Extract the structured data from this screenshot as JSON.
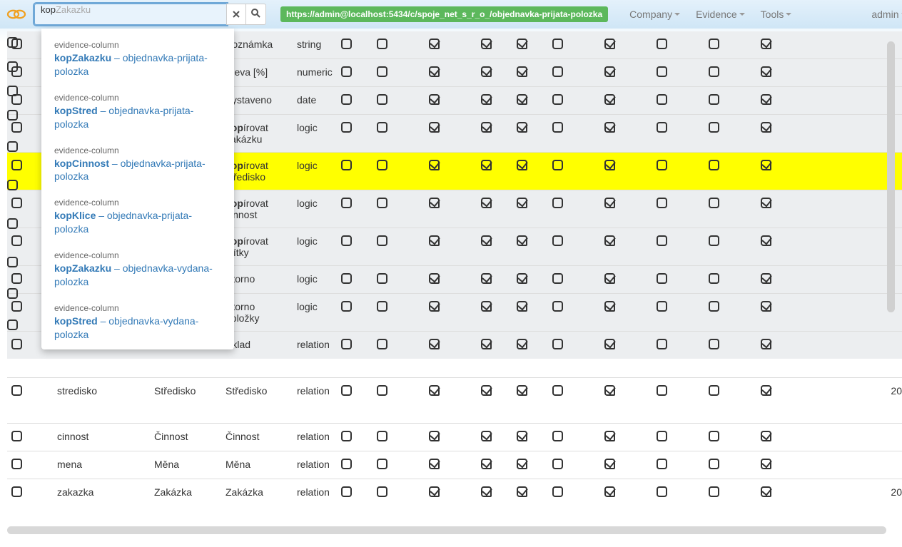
{
  "navbar": {
    "search_typed": "kop",
    "search_hint_rest": "Zakazku",
    "url": "https://admin@localhost:5434/c/spoje_net_s_r_o_/objednavka-prijata-polozka",
    "menu": {
      "company": "Company",
      "evidence": "Evidence",
      "tools": "Tools",
      "admin": "admin"
    }
  },
  "suggestions": [
    {
      "cat": "evidence-column",
      "bold": "kopZakazku",
      "rest": " – objednavka-prijata-polozka"
    },
    {
      "cat": "evidence-column",
      "bold": "kopStred",
      "rest": " – objednavka-prijata-polozka"
    },
    {
      "cat": "evidence-column",
      "bold": "kopCinnost",
      "rest": " – objednavka-prijata-polozka"
    },
    {
      "cat": "evidence-column",
      "bold": "kopKlice",
      "rest": " – objednavka-prijata-polozka"
    },
    {
      "cat": "evidence-column",
      "bold": "kopZakazku",
      "rest": " – objednavka-vydana-polozka"
    },
    {
      "cat": "evidence-column",
      "bold": "kopStred",
      "rest": " – objednavka-vydana-polozka"
    }
  ],
  "rows": [
    {
      "hl": false,
      "prop": "",
      "l1": "",
      "l2_plain": "Poznámka",
      "type": "string",
      "pat": [
        0,
        0,
        1,
        1,
        1,
        0,
        1,
        0,
        0,
        1
      ],
      "tail": ""
    },
    {
      "hl": false,
      "prop": "",
      "l1": "",
      "l2_plain": "Sleva [%]",
      "type": "numeric",
      "pat": [
        0,
        0,
        1,
        1,
        1,
        0,
        1,
        0,
        0,
        1
      ],
      "tail": ""
    },
    {
      "hl": false,
      "prop": "",
      "l1": "",
      "l2_plain": "Vystaveno",
      "type": "date",
      "pat": [
        0,
        0,
        1,
        1,
        1,
        0,
        1,
        0,
        0,
        1
      ],
      "tail": ""
    },
    {
      "hl": false,
      "prop": "",
      "l1": "",
      "l2_bold": "kop",
      "l2_rest": "írovat zakázku",
      "type": "logic",
      "pat": [
        0,
        0,
        1,
        1,
        1,
        0,
        1,
        0,
        0,
        1
      ],
      "tail": ""
    },
    {
      "hl": true,
      "prop": "",
      "l1": "",
      "l2_bold": "kop",
      "l2_rest": "írovat středisko",
      "type": "logic",
      "pat": [
        0,
        0,
        1,
        1,
        1,
        0,
        1,
        0,
        0,
        1
      ],
      "tail": ""
    },
    {
      "hl": false,
      "prop": "",
      "l1": "",
      "l2_bold": "kop",
      "l2_rest": "írovat činnost",
      "type": "logic",
      "pat": [
        0,
        0,
        1,
        1,
        1,
        0,
        1,
        0,
        0,
        1
      ],
      "tail": ""
    },
    {
      "hl": false,
      "prop": "",
      "l1": "",
      "l2_bold": "kop",
      "l2_rest": "írovat štítky",
      "type": "logic",
      "pat": [
        0,
        0,
        1,
        1,
        1,
        0,
        1,
        0,
        0,
        1
      ],
      "tail": ""
    },
    {
      "hl": false,
      "prop": "",
      "l1": "",
      "l2_plain": "Storno",
      "type": "logic",
      "pat": [
        0,
        0,
        1,
        1,
        1,
        0,
        1,
        0,
        0,
        1
      ],
      "tail": ""
    },
    {
      "hl": false,
      "prop": "",
      "l1": "",
      "l2_plain": "Storno položky",
      "type": "logic",
      "pat": [
        0,
        0,
        1,
        1,
        1,
        0,
        1,
        0,
        0,
        1
      ],
      "tail": ""
    },
    {
      "hl": false,
      "prop": "",
      "l1": "",
      "l2_plain": "Sklad",
      "type": "relation",
      "pat": [
        0,
        0,
        1,
        1,
        1,
        0,
        1,
        0,
        0,
        1
      ],
      "tail": ""
    },
    {
      "hl": false,
      "plain": true,
      "prop": "stredisko",
      "l1": "Středisko",
      "l2_plain": "Středisko",
      "type": "relation",
      "pat": [
        0,
        0,
        1,
        1,
        1,
        0,
        1,
        0,
        0,
        1
      ],
      "tail": "20",
      "gap": true
    },
    {
      "hl": false,
      "plain": true,
      "prop": "cinnost",
      "l1": "Činnost",
      "l2_plain": "Činnost",
      "type": "relation",
      "pat": [
        0,
        0,
        1,
        1,
        1,
        0,
        1,
        0,
        0,
        1
      ],
      "tail": "",
      "gap": true
    },
    {
      "hl": false,
      "plain": true,
      "prop": "mena",
      "l1": "Měna",
      "l2_plain": "Měna",
      "type": "relation",
      "pat": [
        0,
        0,
        1,
        1,
        1,
        0,
        1,
        0,
        0,
        1
      ],
      "tail": ""
    },
    {
      "hl": false,
      "plain": true,
      "prop": "zakazka",
      "l1": "Zakázka",
      "l2_plain": "Zakázka",
      "type": "relation",
      "pat": [
        0,
        0,
        1,
        1,
        1,
        0,
        1,
        0,
        0,
        1
      ],
      "tail": "20"
    }
  ],
  "leftcol_cbs": 10
}
